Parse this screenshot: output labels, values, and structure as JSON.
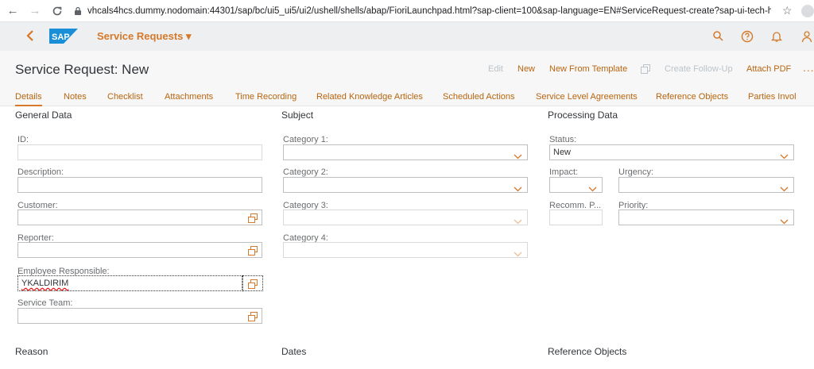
{
  "browser": {
    "url": "vhcals4hcs.dummy.nodomain:44301/sap/bc/ui5_ui5/ui2/ushell/shells/abap/FioriLaunchpad.html?sap-client=100&sap-language=EN#ServiceRequest-create?sap-ui-tech-hint=WCF"
  },
  "shell": {
    "logo_text": "SAP",
    "app_title": "Service Requests ▾"
  },
  "header": {
    "title": "Service Request: New",
    "actions": {
      "edit": "Edit",
      "new": "New",
      "new_from_template": "New From Template",
      "create_follow_up": "Create Follow-Up",
      "attach_pdf": "Attach PDF",
      "more": "..."
    }
  },
  "tabs": [
    "Details",
    "Notes",
    "Checklist",
    "Attachments",
    "Time Recording",
    "Related Knowledge Articles",
    "Scheduled Actions",
    "Service Level Agreements",
    "Reference Objects",
    "Parties Invol"
  ],
  "general": {
    "title": "General Data",
    "id_label": "ID:",
    "description_label": "Description:",
    "customer_label": "Customer:",
    "reporter_label": "Reporter:",
    "employee_label": "Employee Responsible:",
    "employee_value": "YKALDIRIM",
    "service_team_label": "Service Team:"
  },
  "subject": {
    "title": "Subject",
    "cat1": "Category 1:",
    "cat2": "Category 2:",
    "cat3": "Category 3:",
    "cat4": "Category 4:"
  },
  "processing": {
    "title": "Processing Data",
    "status_label": "Status:",
    "status_value": "New",
    "impact_label": "Impact:",
    "urgency_label": "Urgency:",
    "recomm_label": "Recomm. P...",
    "priority_label": "Priority:"
  },
  "bottom": {
    "reason": "Reason",
    "dates": "Dates",
    "reference_objects": "Reference Objects"
  },
  "colors": {
    "accent": "#d6792a",
    "shell_bg": "#edeff0",
    "header_bg": "#f7f7f7"
  }
}
